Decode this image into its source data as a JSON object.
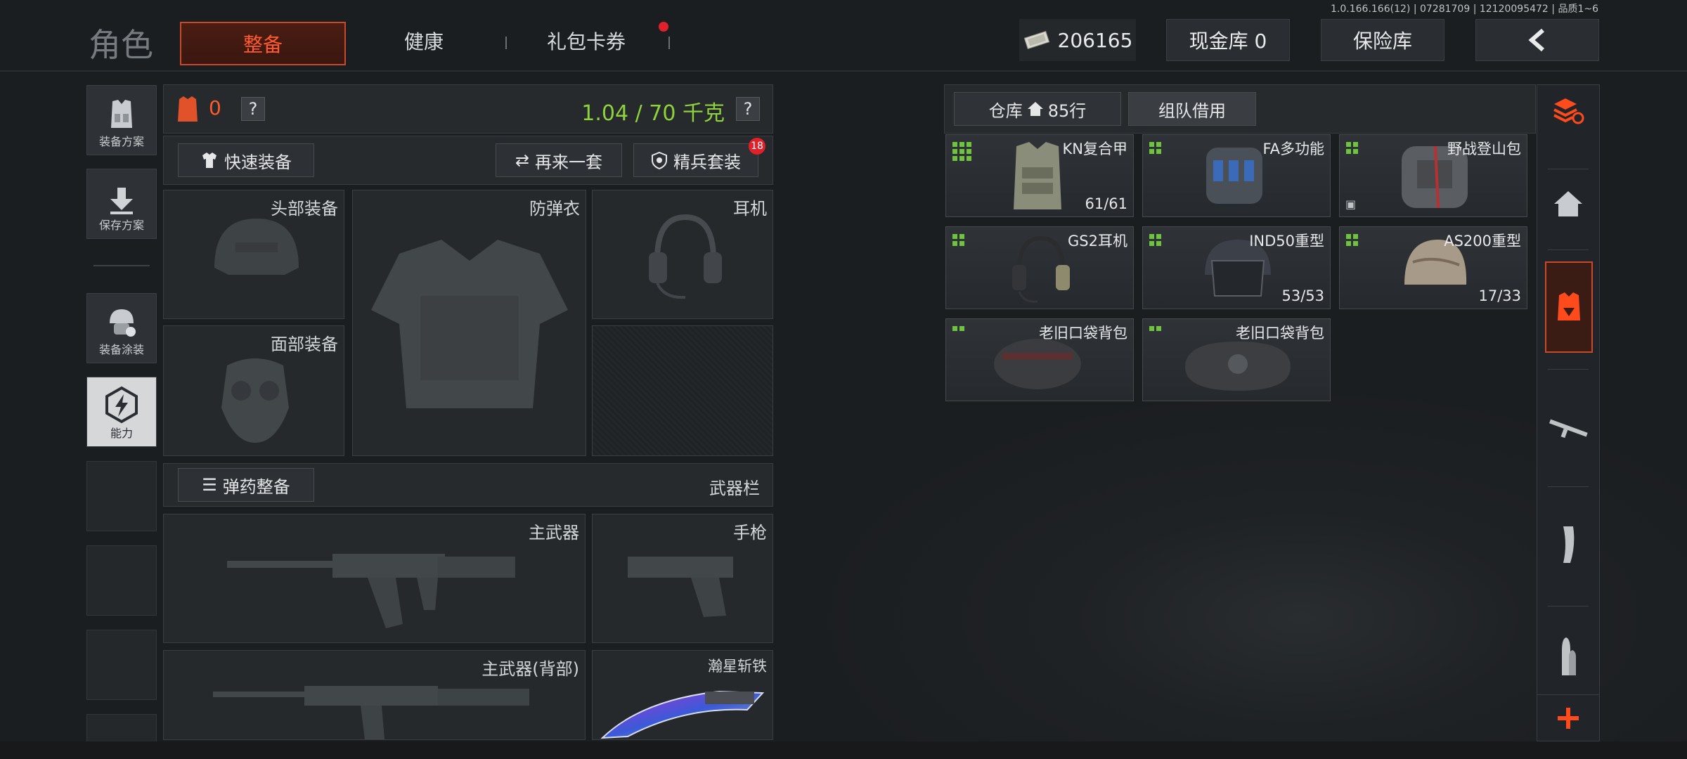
{
  "version": "1.0.166.166(12) | 07281709 | 12120095472 | 品质1~6",
  "header": {
    "title": "角色",
    "tabs": [
      {
        "label": "整备",
        "active": true
      },
      {
        "label": "健康",
        "active": false
      },
      {
        "label": "礼包卡券",
        "active": false,
        "notification_dot": true
      }
    ],
    "currency_value": "206165",
    "cash_storage": "现金库 0",
    "vault": "保险库",
    "back_icon": "chevron-left-icon"
  },
  "left_sidebar": {
    "items": [
      {
        "label": "装备方案",
        "icon": "vest-icon"
      },
      {
        "label": "保存方案",
        "icon": "download-icon"
      },
      {
        "label": "装备涂装",
        "icon": "helmet-paint-icon"
      },
      {
        "label": "能力",
        "icon": "lightning-hex-icon",
        "active": true
      }
    ]
  },
  "loadout": {
    "armor_count": "0",
    "weight_value": "1.04 / 70",
    "weight_unit": "千克",
    "help_symbol": "?",
    "quick_equip": "快速装备",
    "redo": "再来一套",
    "elite_set": "精兵套装",
    "elite_badge": "18",
    "slots": {
      "head": "头部装备",
      "armor": "防弹衣",
      "headset": "耳机",
      "face": "面部装备"
    },
    "ammo_button": "弹药整备",
    "weapon_bar": "武器栏",
    "weapons": {
      "primary": "主武器",
      "pistol": "手枪",
      "primary_back": "主武器(背部)",
      "melee": "瀚星斩铁"
    }
  },
  "storage": {
    "tab_warehouse": "仓库",
    "tab_rows": "85行",
    "tab_team": "组队借用",
    "items": [
      {
        "name": "KN复合甲",
        "count": "61/61",
        "grid": 9
      },
      {
        "name": "FA多功能",
        "count": "",
        "grid": 4
      },
      {
        "name": "野战登山包",
        "count": "",
        "grid": 4
      },
      {
        "name": "GS2耳机",
        "count": "",
        "grid": 4
      },
      {
        "name": "IND50重型",
        "count": "53/53",
        "grid": 4
      },
      {
        "name": "AS200重型",
        "count": "17/33",
        "grid": 4
      },
      {
        "name": "老旧口袋背包",
        "count": "",
        "grid": 2
      },
      {
        "name": "老旧口袋背包",
        "count": "",
        "grid": 2
      }
    ]
  },
  "right_sidebar": {
    "icons": [
      "stack-refresh-icon",
      "home-icon",
      "armor-download-icon",
      "rifle-icon",
      "magazine-icon",
      "bullet-icon",
      "plus-icon"
    ],
    "accent_color": "#ff4a1c"
  },
  "colors": {
    "accent": "#ff5a2c",
    "weight_green": "#8ed23c",
    "grid_green": "#6ec43f"
  }
}
